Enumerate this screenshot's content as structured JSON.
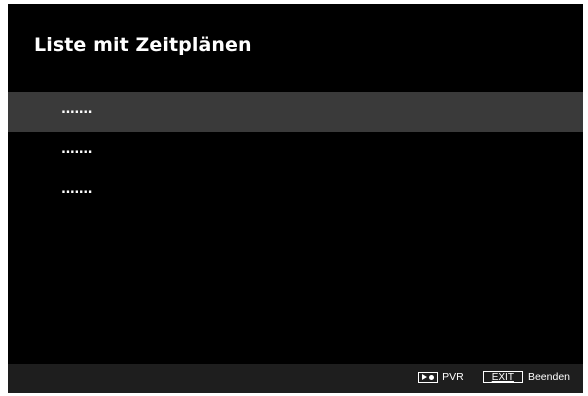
{
  "header": {
    "title": "Liste mit Zeitplänen"
  },
  "schedule_list": {
    "selected_index": 0,
    "items": [
      {
        "label": "......."
      },
      {
        "label": "......."
      },
      {
        "label": "......."
      }
    ]
  },
  "footer": {
    "pvr_icon": "play-record-icon",
    "pvr_label": "PVR",
    "exit_key_label": "EXIT",
    "exit_label": "Beenden"
  },
  "colors": {
    "background": "#000000",
    "selected_row": "#3a3a3a",
    "footer_bar": "#1e1e1e",
    "text": "#ffffff"
  }
}
